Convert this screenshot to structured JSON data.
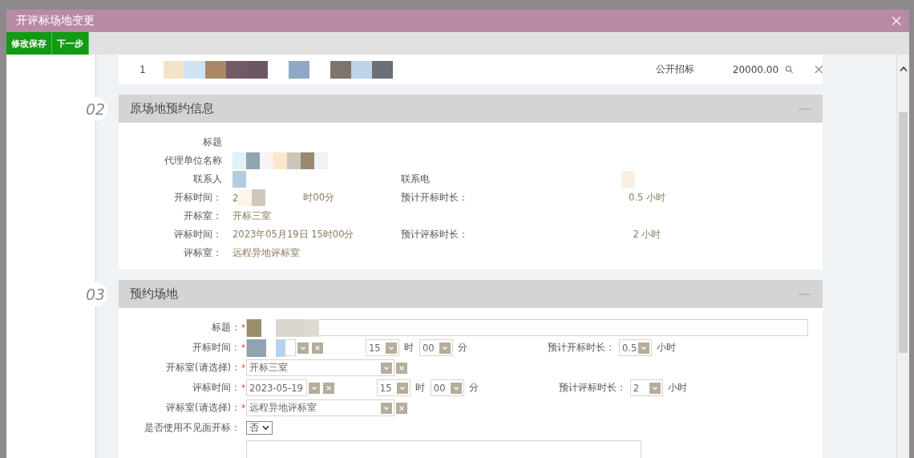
{
  "window": {
    "title": "开评标场地变更"
  },
  "toolbar": [
    {
      "label": "修改保存"
    },
    {
      "label": "下一步"
    }
  ],
  "project_row": {
    "index": "1",
    "redacted": true,
    "method": "公开招标",
    "amount": "20000.00"
  },
  "original_booking": {
    "number": "02",
    "title": "原场地预约信息",
    "expanded": true,
    "rows": [
      {
        "cells": [
          {
            "label": "标题",
            "redacted": false
          }
        ]
      },
      {
        "cells": [
          {
            "label": "代理单位名称",
            "redacted": true
          }
        ]
      },
      {
        "cells": [
          {
            "label": "联系人",
            "redacted": true
          },
          {
            "label": "联系电",
            "redacted": true
          }
        ]
      },
      {
        "cells": [
          {
            "label": "开标时间：",
            "value": "2",
            "redacted": true,
            "value_after": "时00分"
          },
          {
            "label": "预计开标时长：",
            "value": "0.5 小时",
            "redacted": false
          }
        ]
      },
      {
        "cells": [
          {
            "label": "开标室：",
            "value": "开标三室",
            "redacted": false
          }
        ]
      },
      {
        "cells": [
          {
            "label": "评标时间：",
            "value": "2023年05月19日 15时00分",
            "redacted": false
          },
          {
            "label": "预计评标时长：",
            "value": "2 小时",
            "redacted": false
          }
        ]
      },
      {
        "cells": [
          {
            "label": "评标室：",
            "value": "远程异地评标室",
            "redacted": false
          }
        ]
      }
    ]
  },
  "booking": {
    "number": "03",
    "title": "预约场地",
    "expanded": true,
    "rows": [
      {
        "kind": "text",
        "label": "标题：",
        "required_mark": "*",
        "redacted": true
      },
      {
        "kind": "datetime",
        "label": "开标时间：",
        "required_mark": "*",
        "redacted": true,
        "hour": "15",
        "hour_unit": "时",
        "minute": "00",
        "minute_unit": "分",
        "duration_label": "预计开标时长：",
        "duration": "0.5",
        "duration_unit": "小时"
      },
      {
        "kind": "room",
        "label": "开标室(请选择)：",
        "required_mark": "*",
        "value": "开标三室"
      },
      {
        "kind": "datetime",
        "label": "评标时间：",
        "required_mark": "*",
        "redacted": false,
        "date": "2023-05-19",
        "hour": "15",
        "hour_unit": "时",
        "minute": "00",
        "minute_unit": "分",
        "duration_label": "预计评标时长：",
        "duration": "2",
        "duration_unit": "小时"
      },
      {
        "kind": "room",
        "label": "评标室(请选择)：",
        "required_mark": "*",
        "value": "远程异地评标室"
      },
      {
        "kind": "select",
        "label": "是否使用不见面开标：",
        "value": "否"
      },
      {
        "kind": "textarea"
      }
    ]
  }
}
